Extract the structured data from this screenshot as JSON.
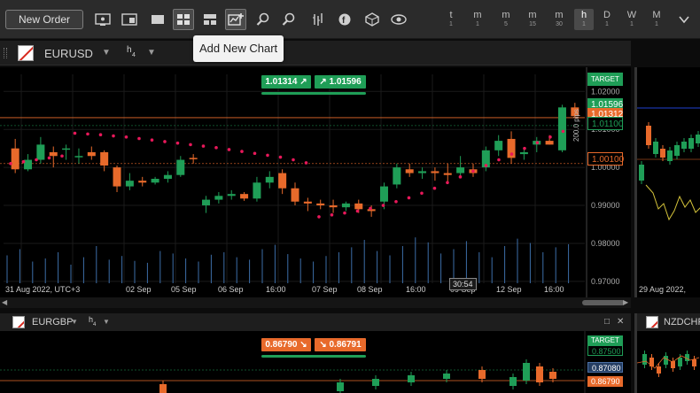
{
  "toolbar": {
    "new_order_label": "New Order",
    "timeframes": [
      {
        "main": "t",
        "sub": "1"
      },
      {
        "main": "m",
        "sub": "1"
      },
      {
        "main": "m",
        "sub": "5"
      },
      {
        "main": "m",
        "sub": "15"
      },
      {
        "main": "m",
        "sub": "30"
      },
      {
        "main": "h",
        "sub": "1"
      },
      {
        "main": "D",
        "sub": "1"
      },
      {
        "main": "W",
        "sub": "1"
      },
      {
        "main": "M",
        "sub": "1"
      }
    ],
    "active_timeframe_index": 5
  },
  "tooltip": {
    "text": "Add New Chart"
  },
  "main_chart": {
    "symbol": "EURUSD",
    "timeframe_main": "h",
    "timeframe_sub": "4",
    "sell_price": "1.01314",
    "buy_price": "1.01596",
    "price_labels": {
      "target": "TARGET",
      "ask": "1.01596",
      "bid": "1.01312",
      "level_green": "1.01100",
      "level_orange": "1.00100"
    },
    "pips_label": "200.0 pips",
    "countdown": "30:54",
    "colors": {
      "bull": "#1f9e57",
      "bear": "#e86a2b",
      "sar": "#e8185a",
      "volume": "#3d6ea8"
    }
  },
  "chart_data": {
    "type": "candlestick",
    "title": "",
    "x_tick_labels": [
      "31 Aug 2022, UTC+3",
      "02 Sep",
      "05 Sep",
      "06 Sep",
      "16:00",
      "07 Sep",
      "08 Sep",
      "16:00",
      "09 Sep",
      "12 Sep",
      "16:00"
    ],
    "y_tick_labels": [
      "1.02000",
      "1.01000",
      "1.00000",
      "0.99000",
      "0.98000",
      "0.97000"
    ],
    "ylim": [
      0.9695,
      1.0245
    ],
    "candles": [
      {
        "o": 1.005,
        "h": 1.0075,
        "l": 0.9985,
        "c": 0.9995
      },
      {
        "o": 0.9995,
        "h": 1.0035,
        "l": 0.999,
        "c": 1.002
      },
      {
        "o": 1.002,
        "h": 1.008,
        "l": 1.001,
        "c": 1.006
      },
      {
        "o": 1.004,
        "h": 1.0055,
        "l": 1.0,
        "c": 1.003
      },
      {
        "o": 1.005,
        "h": 1.006,
        "l": 1.002,
        "c": 1.005
      },
      {
        "o": 1.003,
        "h": 1.005,
        "l": 1.001,
        "c": 1.003
      },
      {
        "o": 1.004,
        "h": 1.0055,
        "l": 1.002,
        "c": 1.003
      },
      {
        "o": 1.004,
        "h": 1.0045,
        "l": 0.999,
        "c": 1.0005
      },
      {
        "o": 1.0,
        "h": 1.0005,
        "l": 0.9935,
        "c": 0.995
      },
      {
        "o": 0.995,
        "h": 0.9985,
        "l": 0.994,
        "c": 0.9965
      },
      {
        "o": 0.9965,
        "h": 0.9975,
        "l": 0.995,
        "c": 0.996
      },
      {
        "o": 0.996,
        "h": 0.9975,
        "l": 0.9955,
        "c": 0.997
      },
      {
        "o": 0.997,
        "h": 0.999,
        "l": 0.996,
        "c": 0.998
      },
      {
        "o": 0.998,
        "h": 1.003,
        "l": 0.9975,
        "c": 1.002
      },
      {
        "o": 1.0025,
        "h": 1.0035,
        "l": 1.001,
        "c": 1.0023
      },
      {
        "o": 0.99,
        "h": 0.9925,
        "l": 0.988,
        "c": 0.9915
      },
      {
        "o": 0.9915,
        "h": 0.9935,
        "l": 0.9905,
        "c": 0.9925
      },
      {
        "o": 0.9925,
        "h": 0.994,
        "l": 0.9915,
        "c": 0.993
      },
      {
        "o": 0.993,
        "h": 0.9935,
        "l": 0.9912,
        "c": 0.9918
      },
      {
        "o": 0.9918,
        "h": 0.9975,
        "l": 0.991,
        "c": 0.996
      },
      {
        "o": 0.996,
        "h": 0.999,
        "l": 0.9945,
        "c": 0.9975
      },
      {
        "o": 0.9985,
        "h": 0.9995,
        "l": 0.993,
        "c": 0.9945
      },
      {
        "o": 0.9945,
        "h": 0.996,
        "l": 0.99,
        "c": 0.991
      },
      {
        "o": 0.991,
        "h": 0.992,
        "l": 0.9885,
        "c": 0.9905
      },
      {
        "o": 0.9905,
        "h": 0.9915,
        "l": 0.989,
        "c": 0.99
      },
      {
        "o": 0.99,
        "h": 0.9915,
        "l": 0.988,
        "c": 0.9895
      },
      {
        "o": 0.9895,
        "h": 0.991,
        "l": 0.9885,
        "c": 0.9905
      },
      {
        "o": 0.9905,
        "h": 0.9915,
        "l": 0.988,
        "c": 0.989
      },
      {
        "o": 0.989,
        "h": 0.99,
        "l": 0.987,
        "c": 0.9885
      },
      {
        "o": 0.991,
        "h": 0.996,
        "l": 0.989,
        "c": 0.995
      },
      {
        "o": 0.9955,
        "h": 1.001,
        "l": 0.9945,
        "c": 1.0
      },
      {
        "o": 0.9995,
        "h": 1.001,
        "l": 0.9975,
        "c": 0.9985
      },
      {
        "o": 0.9985,
        "h": 1.0,
        "l": 0.997,
        "c": 0.999
      },
      {
        "o": 0.999,
        "h": 1.0,
        "l": 0.9965,
        "c": 0.9985
      },
      {
        "o": 0.9985,
        "h": 1.001,
        "l": 0.996,
        "c": 0.998
      },
      {
        "o": 0.9985,
        "h": 1.003,
        "l": 0.9975,
        "c": 1.0
      },
      {
        "o": 0.9995,
        "h": 1.001,
        "l": 0.9975,
        "c": 0.9985
      },
      {
        "o": 1.0,
        "h": 1.0055,
        "l": 0.999,
        "c": 1.0045
      },
      {
        "o": 1.0045,
        "h": 1.0085,
        "l": 1.003,
        "c": 1.007
      },
      {
        "o": 1.0075,
        "h": 1.0095,
        "l": 1.001,
        "c": 1.0025
      },
      {
        "o": 1.0035,
        "h": 1.005,
        "l": 1.002,
        "c": 1.004
      },
      {
        "o": 1.006,
        "h": 1.008,
        "l": 1.004,
        "c": 1.007
      },
      {
        "o": 1.007,
        "h": 1.0085,
        "l": 1.006,
        "c": 1.006
      },
      {
        "o": 1.0045,
        "h": 1.0165,
        "l": 1.004,
        "c": 1.0158
      },
      {
        "o": 1.0158,
        "h": 1.017,
        "l": 1.013,
        "c": 1.0135
      }
    ],
    "sar": [
      1.001,
      1.0015,
      1.002,
      1.0025,
      1.003,
      1.009,
      1.0088,
      1.0086,
      1.0083,
      1.008,
      1.0076,
      1.0072,
      1.0068,
      1.0064,
      1.006,
      1.0056,
      1.0052,
      1.0047,
      1.0042,
      1.0037,
      1.0032,
      1.0027,
      1.002,
      1.0012,
      0.987,
      0.9875,
      0.988,
      0.9885,
      0.9892,
      0.99,
      0.991,
      0.992,
      0.9932,
      0.9945,
      0.996,
      0.9975,
      0.999,
      1.0005,
      1.002,
      1.0035,
      1.005,
      1.0065,
      1.008,
      1.0095
    ],
    "volume": [
      0.45,
      0.55,
      0.35,
      0.4,
      0.5,
      0.3,
      0.42,
      0.6,
      0.38,
      0.44,
      0.36,
      0.33,
      0.52,
      0.48,
      0.4,
      0.35,
      0.46,
      0.5,
      0.42,
      0.38,
      0.55,
      0.62,
      0.47,
      0.4,
      0.35,
      0.44,
      0.5,
      0.58,
      0.7,
      0.52,
      0.45,
      0.6,
      0.74,
      0.66,
      0.48,
      0.55,
      0.68,
      0.5,
      0.42,
      0.6,
      0.72,
      0.65,
      0.5,
      0.58,
      0.63
    ]
  },
  "bottom_left": {
    "symbol": "EURGBP",
    "timeframe_main": "h",
    "timeframe_sub": "4",
    "sell_price": "0.86790",
    "buy_price": "0.86791",
    "labels": {
      "target": "TARGET",
      "l1": "0.87500",
      "l2": "0.87080",
      "l3": "0.86790"
    }
  },
  "bottom_right": {
    "symbol": "NZDCHF"
  },
  "right_chart": {
    "date_label": "29 Aug 2022,"
  }
}
